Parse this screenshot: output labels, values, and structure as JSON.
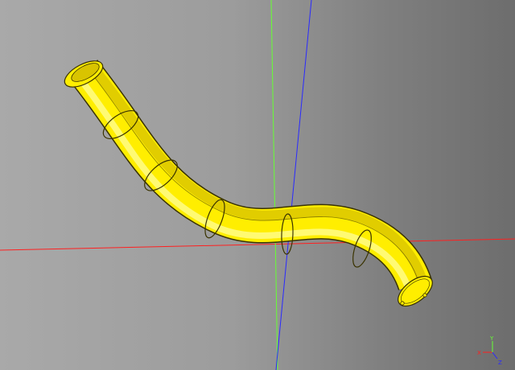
{
  "viewport": {
    "background_left": "#a9a9a9",
    "background_right": "#6d6d6d"
  },
  "model": {
    "body_color": "#ffee00",
    "shade_color": "#d9c400",
    "highlight_color": "#fffb80",
    "edge_color": "#3a3300"
  },
  "axes": {
    "x_color": "#ff2020",
    "y_color": "#66ff33",
    "z_color": "#2a2aff"
  },
  "triad": {
    "x_label": "X",
    "y_label": "Y",
    "z_label": "Z"
  }
}
